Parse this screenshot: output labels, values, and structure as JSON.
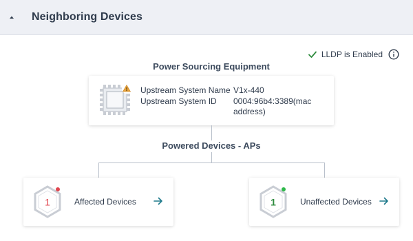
{
  "header": {
    "title": "Neighboring Devices"
  },
  "lldp": {
    "status": "LLDP is Enabled"
  },
  "pse": {
    "title": "Power Sourcing Equipment",
    "system_name_label": "Upstream System Name",
    "system_name_value": "V1x-440",
    "system_id_label": "Upstream System ID",
    "system_id_value": "0004:96b4:3389(mac address)"
  },
  "powered": {
    "title": "Powered Devices - APs",
    "affected": {
      "count": "1",
      "label": "Affected Devices",
      "color": "#e0464f"
    },
    "unaffected": {
      "count": "1",
      "label": "Unaffected Devices",
      "color": "#2e8b3e"
    }
  },
  "colors": {
    "accent": "#1f7a8c",
    "warning": "#e8a33d",
    "success": "#2e8b3e",
    "error": "#e0464f"
  }
}
